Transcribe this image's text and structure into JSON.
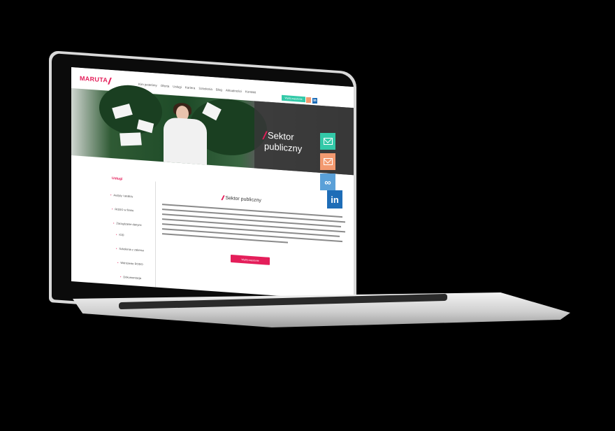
{
  "brand": {
    "logo_text": "MARUTA",
    "accent": "#e41e5a",
    "teal": "#33c9a8"
  },
  "nav": {
    "items": [
      "Kim jesteśmy",
      "Oferta",
      "Usługi",
      "Kariera",
      "Szkolenia",
      "Blog",
      "Aktualności",
      "Kontakt"
    ],
    "cta_label": "Wyślij zapytanie",
    "social": [
      "google-plus-icon",
      "linkedin-icon"
    ]
  },
  "hero": {
    "title_line1": "Sektor",
    "title_line2": "publiczny"
  },
  "sidebar": {
    "title": "Usługi",
    "items": [
      "Audyty i analizy",
      "RODO w firmie",
      "Zarządzanie danymi",
      "IOD",
      "Szkolenia z zakresu",
      "Wdrożenie RODO",
      "Dokumentacja"
    ]
  },
  "content": {
    "title": "Sektor publiczny",
    "cta_label": "Wyślij zapytanie"
  },
  "side_buttons": [
    "mail-icon",
    "newsletter-icon",
    "link-icon",
    "linkedin-icon"
  ]
}
